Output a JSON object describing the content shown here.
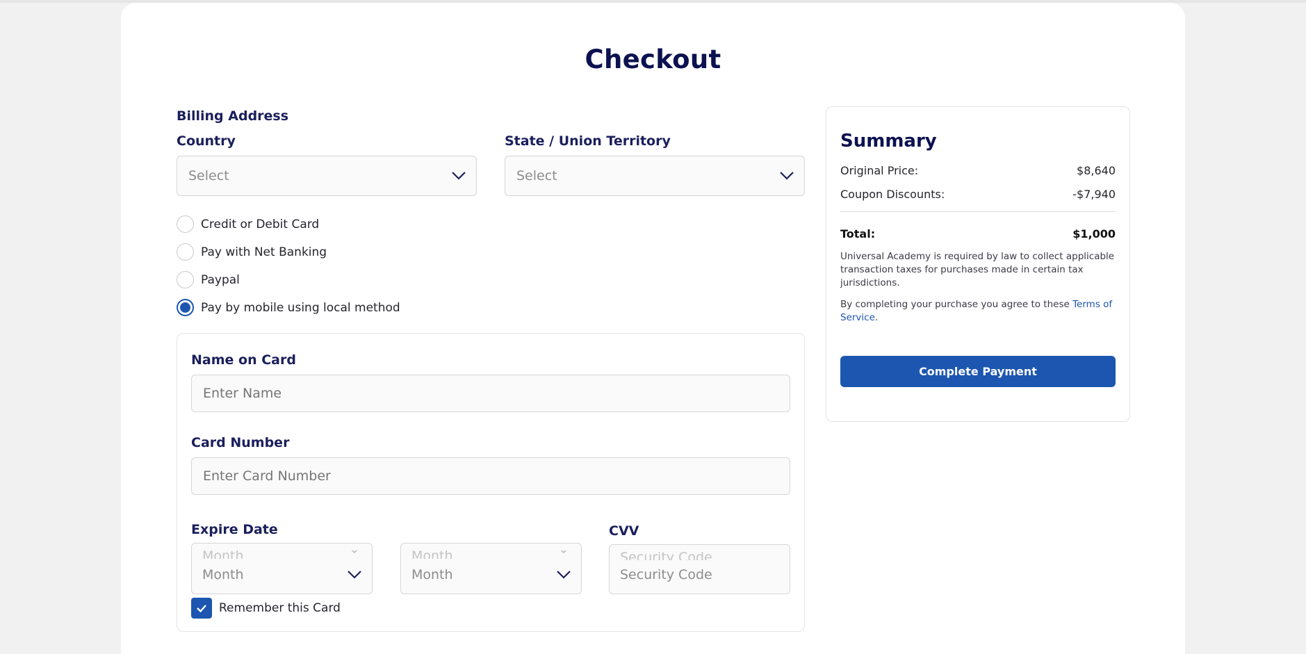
{
  "page": {
    "title": "Checkout"
  },
  "billing": {
    "section_label": "Billing Address",
    "country_label": "Country",
    "country_value": "Select",
    "state_label": "State / Union Territory",
    "state_value": "Select"
  },
  "payment_methods": [
    {
      "label": "Credit or Debit Card",
      "selected": false
    },
    {
      "label": "Pay with Net Banking",
      "selected": false
    },
    {
      "label": "Paypal",
      "selected": false
    },
    {
      "label": "Pay by mobile using local method",
      "selected": true
    }
  ],
  "card_form": {
    "name_label": "Name on Card",
    "name_placeholder": "Enter Name",
    "number_label": "Card Number",
    "number_placeholder": "Enter Card Number",
    "expire_label": "Expire Date",
    "month_1": "Month",
    "month_2": "Month",
    "cvv_label": "CVV",
    "cvv_placeholder": "Security Code",
    "remember_label": "Remember this Card",
    "remember_checked": true
  },
  "summary": {
    "title": "Summary",
    "original_price_label": "Original Price:",
    "original_price_value": "$8,640",
    "coupon_label": "Coupon Discounts:",
    "coupon_value": "-$7,940",
    "total_label": "Total:",
    "total_value": "$1,000",
    "tax_note": "Universal Academy is required by law to collect applicable transaction taxes for purchases made in certain tax jurisdictions.",
    "agree_text": "By completing your purchase you agree to these ",
    "terms_link": "Terms of Service",
    "agree_end": ".",
    "cta_label": "Complete Payment"
  },
  "colors": {
    "navy": "#0c1150",
    "accent": "#1c56b0",
    "background": "#f1f1f1"
  },
  "icons": {
    "select_arrow": "chevron-down-icon",
    "checkbox": "check-icon"
  }
}
